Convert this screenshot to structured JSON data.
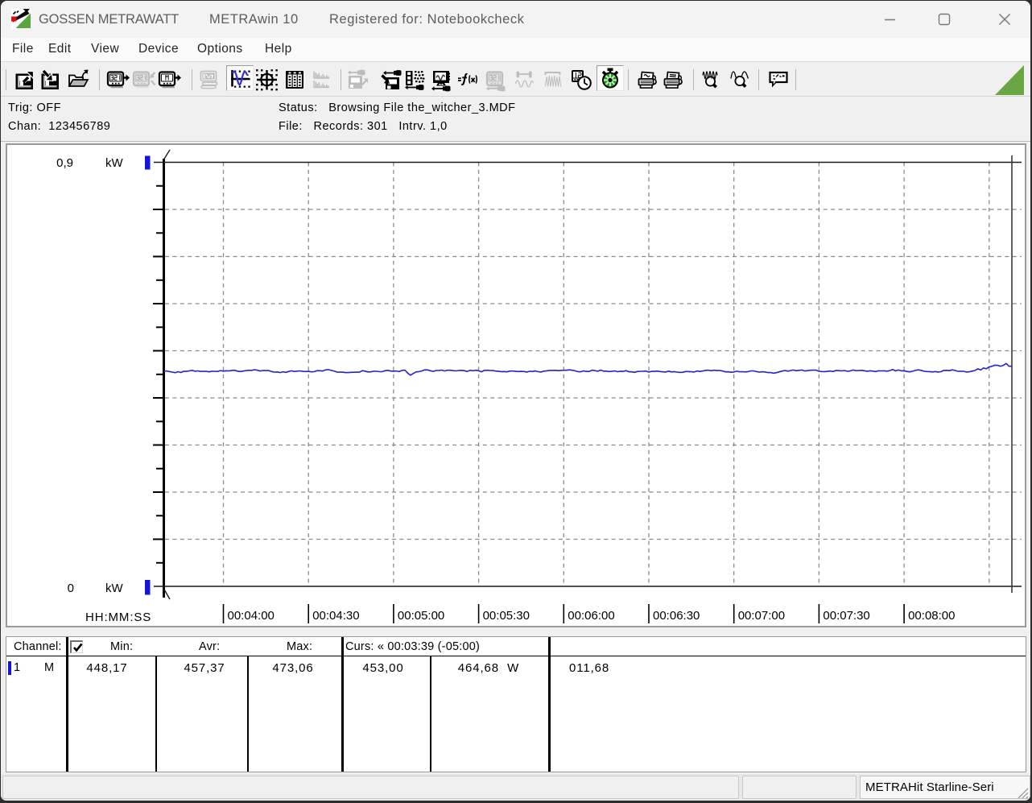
{
  "window": {
    "app_title": "GOSSEN METRAWATT",
    "product": "METRAwin 10",
    "registered": "Registered for: Notebookcheck"
  },
  "menu": {
    "items": [
      "File",
      "Edit",
      "View",
      "Device",
      "Options",
      "Help"
    ]
  },
  "toolbar": {
    "wedge_color": "#6aa644",
    "buttons": [
      {
        "name": "save-export",
        "disabled": false
      },
      {
        "name": "save-import",
        "disabled": false
      },
      {
        "name": "open-file",
        "disabled": false
      },
      {
        "name": "read-device-321",
        "disabled": false
      },
      {
        "name": "write-device-321",
        "disabled": true
      },
      {
        "name": "read-device-memory",
        "disabled": false
      },
      {
        "name": "multi-display",
        "disabled": true
      },
      {
        "name": "waveform-view",
        "disabled": false,
        "active": true
      },
      {
        "name": "xy-view",
        "disabled": false
      },
      {
        "name": "table-view",
        "disabled": false
      },
      {
        "name": "histogram-view",
        "disabled": true
      },
      {
        "name": "export-picture",
        "disabled": true
      },
      {
        "name": "save-online",
        "disabled": false
      },
      {
        "name": "channel-setup",
        "disabled": false
      },
      {
        "name": "display-setup",
        "disabled": false
      },
      {
        "name": "function-setup",
        "disabled": false
      },
      {
        "name": "device-setup",
        "disabled": true
      },
      {
        "name": "trigger-setup",
        "disabled": true
      },
      {
        "name": "envelope",
        "disabled": true
      },
      {
        "name": "time-setup",
        "disabled": false
      },
      {
        "name": "timer-active",
        "disabled": false,
        "active": true
      },
      {
        "name": "print-preview",
        "disabled": false
      },
      {
        "name": "print",
        "disabled": false
      },
      {
        "name": "zoom-in-curve",
        "disabled": false
      },
      {
        "name": "zoom-out-curve",
        "disabled": false
      },
      {
        "name": "notes",
        "disabled": false
      }
    ]
  },
  "status_panel": {
    "trig_label": "Trig:",
    "trig_value": "OFF",
    "chan_label": "Chan:",
    "chan_value": "123456789",
    "status_label": "Status:",
    "status_value": "Browsing File the_witcher_3.MDF",
    "file_label": "File:",
    "file_value": "Records: 301   Intrv. 1,0"
  },
  "chart_data": {
    "type": "line",
    "title": "",
    "ylabel": "kW",
    "xlabel": "HH:MM:SS",
    "y_axis": {
      "min": 0,
      "max": 0.9,
      "min_label": "0",
      "max_label": "0,9",
      "unit": "kW",
      "grid_step": 0.1,
      "tick_step": 0.05,
      "marker_color": "#1414dc"
    },
    "x_axis": {
      "label": "HH:MM:SS",
      "view_start_s": 219,
      "view_end_s": 521,
      "tick_interval_s": 30,
      "tick_labels": [
        "00:04:00",
        "00:04:30",
        "00:05:00",
        "00:05:30",
        "00:06:00",
        "00:06:30",
        "00:07:00",
        "00:07:30",
        "00:08:00"
      ]
    },
    "cursor": {
      "time_s": 518
    },
    "series": [
      {
        "name": "1 M",
        "unit": "W",
        "color": "#2323cc",
        "t0_s": 218,
        "dt_s": 1,
        "values_w": [
          455.89,
          456.42,
          457.06,
          455.92,
          454.75,
          453.51,
          455.49,
          453.93,
          456.46,
          456.17,
          457.26,
          458.54,
          456.62,
          457.25,
          456.0,
          456.46,
          456.2,
          455.17,
          456.57,
          456.43,
          456.05,
          457.91,
          456.79,
          457.57,
          457.31,
          458.34,
          458.69,
          456.83,
          455.84,
          456.98,
          457.77,
          458.61,
          458.23,
          459.83,
          458.69,
          457.05,
          458.18,
          457.87,
          457.89,
          455.93,
          454.65,
          455.02,
          453.74,
          455.43,
          454.11,
          455.94,
          457.48,
          456.1,
          456.79,
          457.21,
          456.17,
          455.97,
          456.2,
          455.13,
          455.57,
          457.71,
          457.58,
          457.06,
          459.4,
          460.07,
          458.32,
          457.13,
          454.86,
          454.6,
          454.51,
          453.71,
          453.73,
          454.15,
          454.31,
          454.58,
          454.46,
          457.72,
          456.81,
          454.96,
          455.22,
          456.52,
          456.49,
          455.59,
          455.8,
          457.76,
          458.46,
          456.86,
          456.59,
          457.04,
          455.71,
          458.34,
          459.02,
          452.4,
          448.17,
          451.9,
          455.27,
          455.73,
          457.24,
          459.52,
          459.37,
          457.53,
          456.31,
          458.05,
          458.3,
          459.01,
          457.1,
          458.7,
          458.62,
          457.75,
          457.25,
          458.12,
          458.48,
          457.63,
          456.14,
          458.7,
          457.36,
          458.66,
          457.65,
          455.44,
          458.3,
          458.65,
          458.13,
          457.87,
          456.89,
          456.6,
          455.79,
          455.91,
          455.26,
          456.88,
          456.97,
          456.58,
          455.93,
          456.16,
          455.88,
          454.84,
          456.38,
          456.05,
          457.06,
          455.64,
          454.85,
          456.69,
          457.49,
          458.25,
          458.36,
          458.39,
          457.7,
          458.24,
          458.66,
          458.68,
          459.52,
          458.66,
          457.41,
          455.64,
          455.42,
          457.33,
          456.12,
          456.02,
          458.84,
          457.71,
          456.65,
          458.94,
          456.83,
          456.79,
          455.85,
          456.3,
          457.24,
          455.51,
          456.64,
          456.32,
          457.71,
          455.32,
          455.27,
          454.12,
          456.01,
          456.4,
          456.62,
          456.84,
          454.64,
          456.41,
          456.21,
          456.91,
          455.98,
          455.21,
          454.92,
          456.74,
          454.96,
          455.71,
          454.67,
          453.94,
          454.36,
          455.88,
          455.96,
          455.4,
          454.91,
          457.01,
          456.0,
          457.02,
          458.43,
          458.74,
          457.54,
          458.87,
          457.88,
          458.14,
          457.12,
          455.29,
          455.44,
          454.31,
          454.93,
          456.63,
          455.45,
          455.59,
          454.97,
          455.81,
          457.19,
          457.18,
          455.76,
          454.62,
          455.47,
          455.07,
          453.76,
          453.64,
          452.56,
          453.47,
          455.24,
          456.85,
          458.1,
          456.7,
          457.93,
          459.1,
          457.55,
          458.46,
          459.2,
          457.14,
          457.74,
          458.69,
          458.79,
          458.73,
          456.35,
          455.82,
          455.8,
          456.2,
          457.06,
          455.94,
          458.31,
          457.74,
          457.24,
          458.06,
          456.38,
          457.1,
          459.09,
          457.7,
          457.96,
          458.53,
          457.67,
          456.53,
          457.44,
          456.94,
          455.87,
          457.43,
          457.29,
          457.51,
          456.67,
          457.98,
          460.38,
          457.32,
          459.16,
          457.41,
          457.55,
          456.14,
          455.29,
          456.57,
          458.22,
          459.46,
          458.42,
          456.65,
          455.87,
          455.77,
          455.06,
          455.95,
          454.81,
          455.57,
          458.24,
          458.52,
          457.8,
          459.45,
          458.1,
          456.42,
          456.6,
          456.48,
          454.95,
          455.4,
          456.76,
          458.06,
          461.72,
          459.17,
          463.44,
          461.84,
          465.59,
          467.23,
          469.39,
          469.0,
          467.04,
          469.06,
          473.06,
          467.26,
          467.11
        ]
      }
    ]
  },
  "table": {
    "header": {
      "channel": "Channel:",
      "checkbox_checked": true,
      "min": "Min:",
      "avr": "Avr:",
      "max": "Max:",
      "curs": "Curs: « 00:03:39 (-05:00)"
    },
    "row": {
      "channel": "1",
      "mode": "M",
      "min": "448,17",
      "avr": "457,37",
      "max": "473,06",
      "curs_left": "453,00",
      "curs_right": "464,68",
      "curs_unit": "W",
      "delta": "011,68"
    }
  },
  "statusbar": {
    "device": "METRAHit Starline-Seri"
  }
}
